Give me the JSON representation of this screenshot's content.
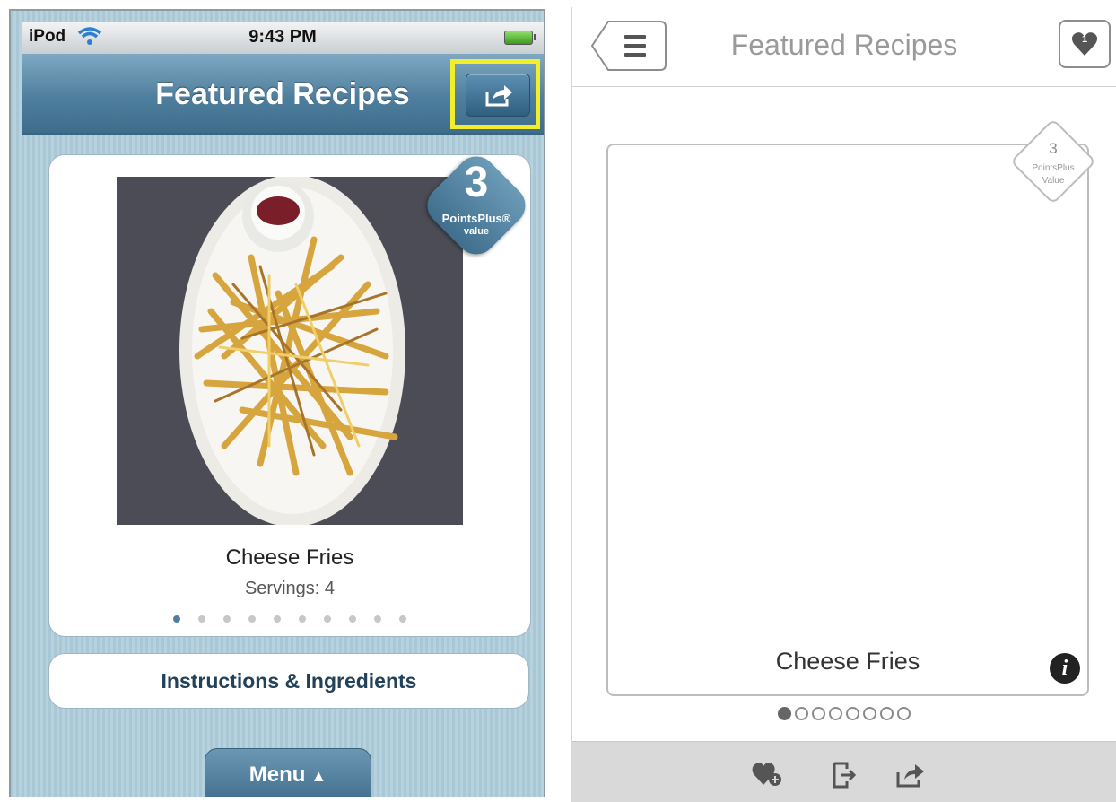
{
  "left_screen": {
    "status_bar": {
      "carrier": "iPod",
      "time": "9:43 PM"
    },
    "nav": {
      "title": "Featured Recipes",
      "share_icon": "share-icon"
    },
    "recipe": {
      "name": "Cheese Fries",
      "servings": "Servings: 4"
    },
    "points_badge": {
      "value": "3",
      "label": "PointsPlus®",
      "sub": "value"
    },
    "pager": {
      "count": 10,
      "active_index": 0
    },
    "instructions_label": "Instructions & Ingredients",
    "menu_label": "Menu"
  },
  "right_screen": {
    "title": "Featured Recipes",
    "favorites_count": "1",
    "points_badge": {
      "value": "3",
      "label": "PointsPlus",
      "sub": "Value"
    },
    "recipe_name": "Cheese Fries",
    "pager": {
      "count": 8,
      "active_index": 0
    },
    "toolbar": [
      "favorite-add-icon",
      "save-icon",
      "share-icon"
    ]
  },
  "colors": {
    "highlight": "#f2ee2c",
    "nav_blue": "#4f7f9e",
    "link_text": "#23425a"
  }
}
